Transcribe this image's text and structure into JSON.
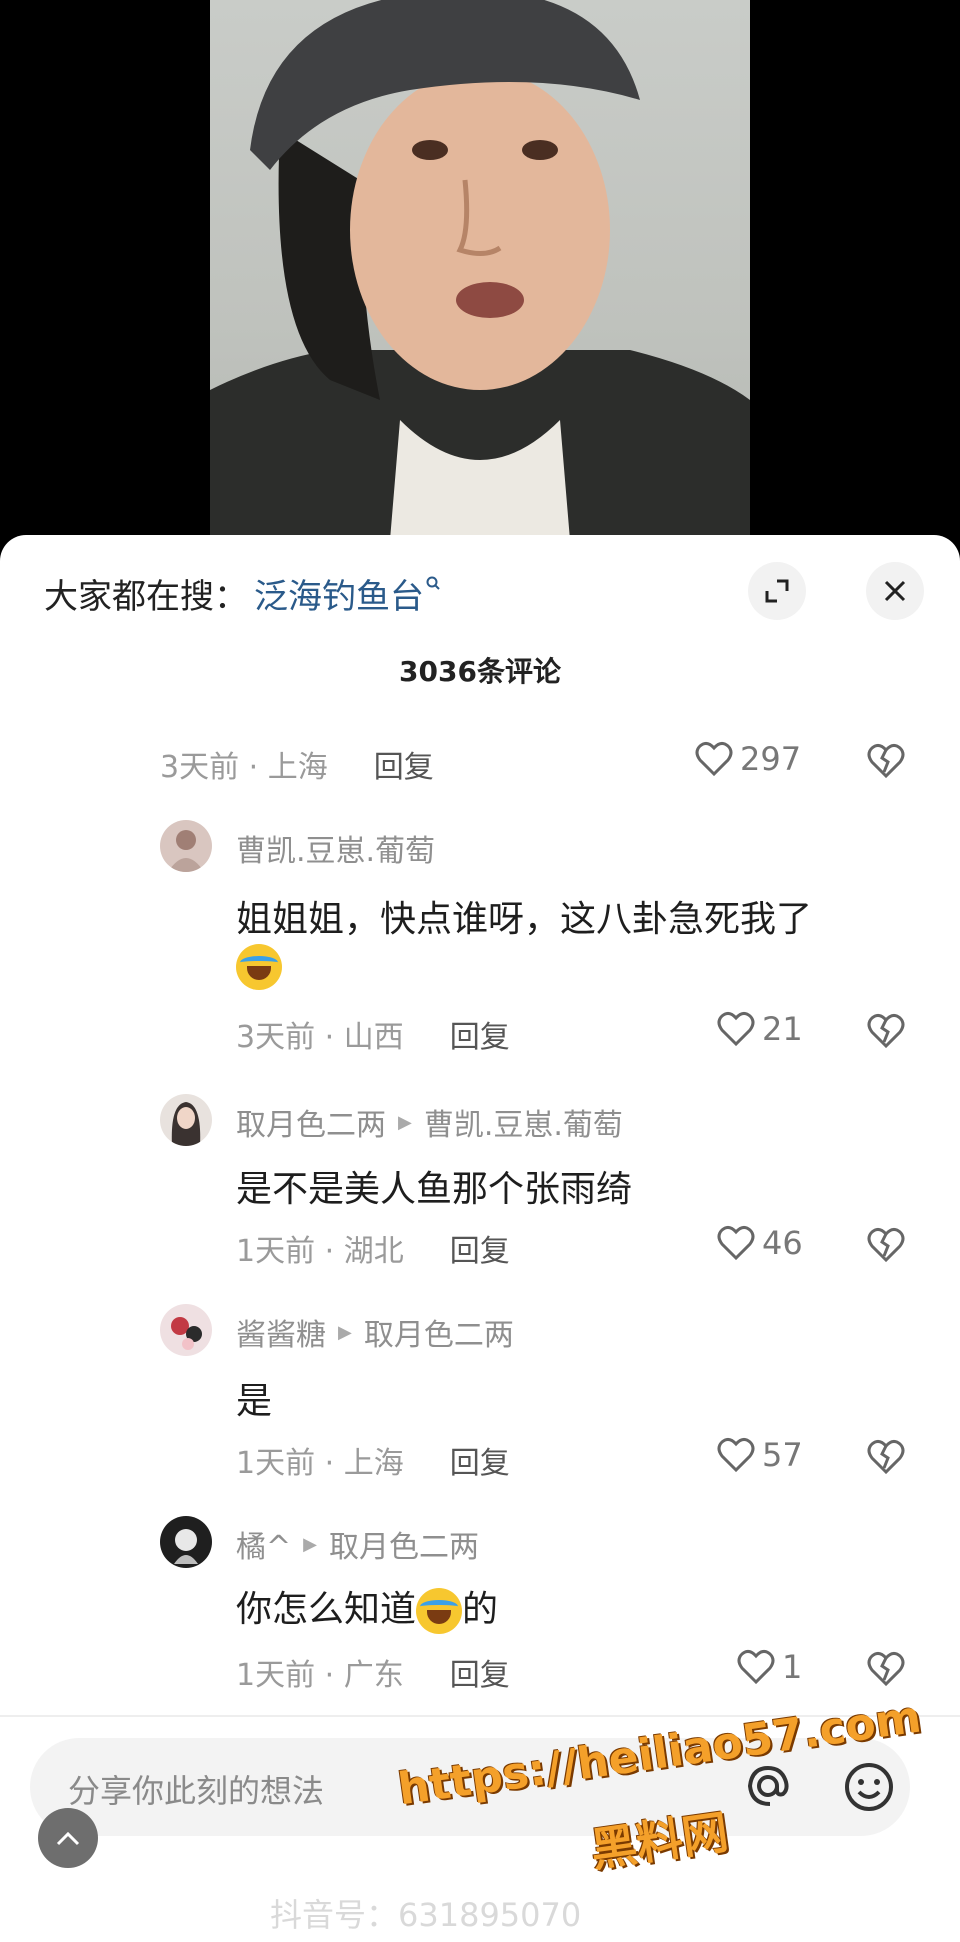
{
  "search": {
    "prefix": "大家都在搜：",
    "term": "泛海钓鱼台"
  },
  "comments_count": "3036条评论",
  "top_meta": {
    "time": "3天前 · 上海",
    "reply": "回复",
    "likes": "297"
  },
  "replies": [
    {
      "user": "曹凯.豆崽.葡萄",
      "target": "",
      "text": "姐姐姐，快点谁呀，这八卦急死我了",
      "emoji_after": true,
      "time": "3天前 · 山西",
      "reply": "回复",
      "likes": "21"
    },
    {
      "user": "取月色二两",
      "target": "曹凯.豆崽.葡萄",
      "text": "是不是美人鱼那个张雨绮",
      "time": "1天前 · 湖北",
      "reply": "回复",
      "likes": "46"
    },
    {
      "user": "酱酱糖",
      "target": "取月色二两",
      "text": "是",
      "time": "1天前 · 上海",
      "reply": "回复",
      "likes": "57"
    },
    {
      "user": "橘^",
      "target": "取月色二两",
      "text_a": "你怎么知道",
      "text_b": "的",
      "time": "1天前 · 广东",
      "reply": "回复",
      "likes": "1"
    }
  ],
  "input": {
    "placeholder": "分享你此刻的想法"
  },
  "watermark": {
    "url": "https://heiliao57.com",
    "name": "黑料网"
  },
  "bottom_watermark": "抖音号：631895070",
  "icons": [
    "expand-icon",
    "close-icon",
    "heart-icon",
    "broken-heart-icon",
    "at-icon",
    "emoji-icon",
    "chevron-up-icon",
    "search-icon"
  ]
}
